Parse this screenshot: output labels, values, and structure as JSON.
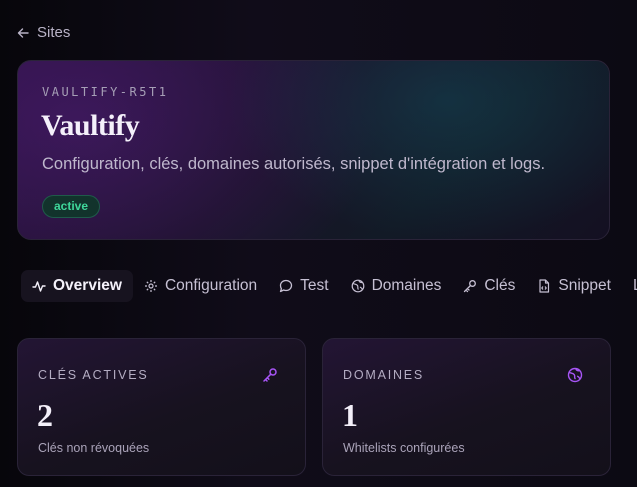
{
  "back": {
    "label": "Sites"
  },
  "hero": {
    "site_id": "VAULTIFY-R5T1",
    "title": "Vaultify",
    "description": "Configuration, clés, domaines autorisés, snippet d'intégration et logs.",
    "status": "active"
  },
  "tabs": [
    {
      "label": "Overview",
      "icon": "activity-icon",
      "active": true
    },
    {
      "label": "Configuration",
      "icon": "gear-icon",
      "active": false
    },
    {
      "label": "Test",
      "icon": "chat-bubble-icon",
      "active": false
    },
    {
      "label": "Domaines",
      "icon": "globe-icon",
      "active": false
    },
    {
      "label": "Clés",
      "icon": "key-icon",
      "active": false
    },
    {
      "label": "Snippet",
      "icon": "file-code-icon",
      "active": false
    },
    {
      "label": "L",
      "icon": "",
      "active": false
    }
  ],
  "stats": [
    {
      "label": "CLÉS ACTIVES",
      "value": "2",
      "sub": "Clés non révoquées",
      "icon": "key-icon"
    },
    {
      "label": "DOMAINES",
      "value": "1",
      "sub": "Whitelists configurées",
      "icon": "globe-icon"
    }
  ],
  "colors": {
    "accent": "#a855f7",
    "status_active": "#3fd69a"
  }
}
